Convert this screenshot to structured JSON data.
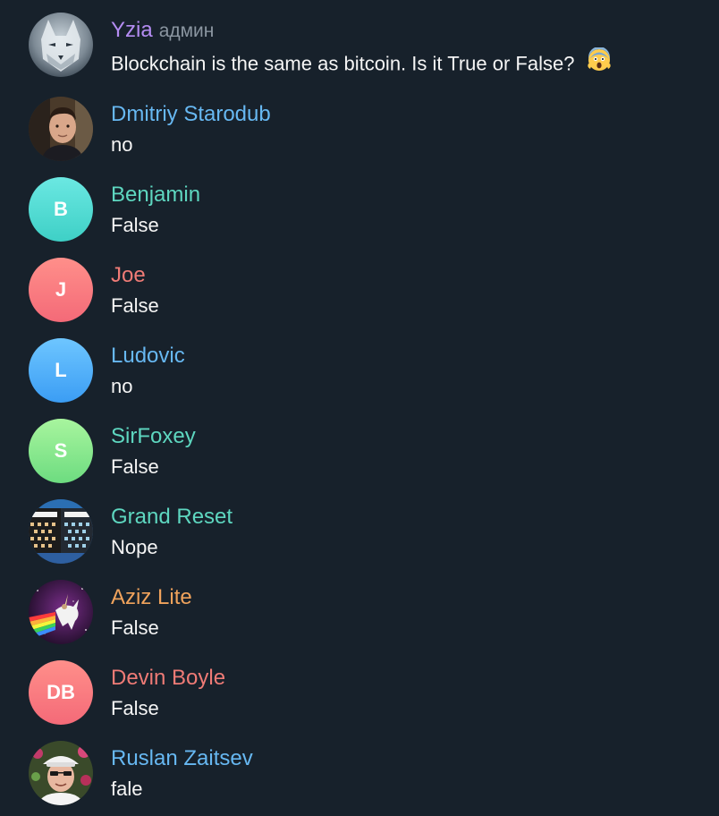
{
  "messages": [
    {
      "name": "Yzia",
      "role": "админ",
      "name_color": "#b48cf2",
      "text": "Blockchain is the same as bitcoin. Is it True or False?",
      "emoji": "face-screaming-in-fear-emoji",
      "avatar": {
        "type": "photo",
        "icon": "wolf-photo-avatar"
      }
    },
    {
      "name": "Dmitriy Starodub",
      "role": "",
      "name_color": "#67b8f2",
      "text": "no",
      "avatar": {
        "type": "photo",
        "icon": "man-portrait-photo-avatar"
      }
    },
    {
      "name": "Benjamin",
      "role": "",
      "name_color": "#5ed7c0",
      "text": "False",
      "avatar": {
        "type": "initials",
        "initials": "B",
        "gradient": [
          "#6be8e2",
          "#3ed0c6"
        ]
      }
    },
    {
      "name": "Joe",
      "role": "",
      "name_color": "#ef7b76",
      "text": "False",
      "avatar": {
        "type": "initials",
        "initials": "J",
        "gradient": [
          "#ff8f8a",
          "#f46a78"
        ]
      }
    },
    {
      "name": "Ludovic",
      "role": "",
      "name_color": "#67b8f2",
      "text": "no",
      "avatar": {
        "type": "initials",
        "initials": "L",
        "gradient": [
          "#6ec6ff",
          "#3b9df4"
        ]
      }
    },
    {
      "name": "SirFoxey",
      "role": "",
      "name_color": "#5ed7c0",
      "text": "False",
      "avatar": {
        "type": "initials",
        "initials": "S",
        "gradient": [
          "#a8f59e",
          "#6ddc80"
        ]
      }
    },
    {
      "name": "Grand Reset",
      "role": "",
      "name_color": "#5ed7c0",
      "text": "Nope",
      "avatar": {
        "type": "photo",
        "icon": "bitcoin-sweaters-photo-avatar"
      }
    },
    {
      "name": "Aziz Lite",
      "role": "",
      "name_color": "#f0a35c",
      "text": "False",
      "avatar": {
        "type": "photo",
        "icon": "unicorn-rainbow-photo-avatar"
      }
    },
    {
      "name": "Devin Boyle",
      "role": "",
      "name_color": "#ef7b76",
      "text": "False",
      "avatar": {
        "type": "initials",
        "initials": "DB",
        "gradient": [
          "#ff8f8a",
          "#f46a78"
        ]
      }
    },
    {
      "name": "Ruslan Zaitsev",
      "role": "",
      "name_color": "#67b8f2",
      "text": "fale",
      "avatar": {
        "type": "photo",
        "icon": "man-in-hat-photo-avatar"
      }
    }
  ]
}
